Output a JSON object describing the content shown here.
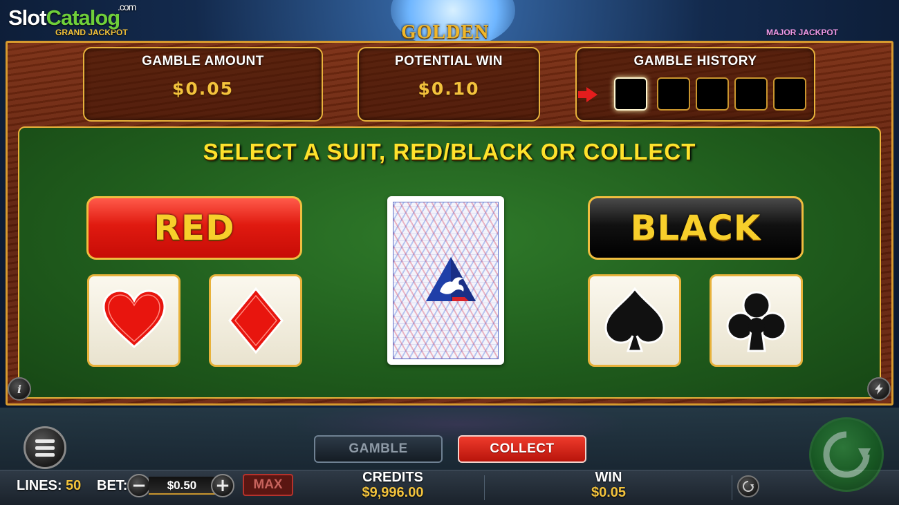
{
  "watermark": {
    "part1": "Slot",
    "part2": "Catalog",
    "suffix": ".com"
  },
  "header": {
    "grand_jackpot_label": "GRAND JACKPOT",
    "game_logo": "GOLDEN",
    "major_jackpot_label": "MAJOR JACKPOT"
  },
  "gamble_amount": {
    "title": "GAMBLE AMOUNT",
    "value": "$0.05"
  },
  "potential_win": {
    "title": "POTENTIAL WIN",
    "value": "$0.10"
  },
  "gamble_history": {
    "title": "GAMBLE HISTORY",
    "slots": 5,
    "current_slot": 1
  },
  "instruction": "SELECT A SUIT, RED/BLACK OR COLLECT",
  "color_choices": {
    "red": "RED",
    "black": "BLACK"
  },
  "suits": [
    "hearts-icon",
    "diamonds-icon",
    "spades-icon",
    "clubs-icon"
  ],
  "colors": {
    "red": "#e01a10",
    "gold": "#f3c33c",
    "felt": "#2f7a2a",
    "wood": "#6e2610"
  },
  "bottom": {
    "lines_label": "LINES:",
    "lines_value": "50",
    "bet_label": "BET:",
    "bet_value": "$0.50",
    "max_label": "MAX",
    "credits_label": "CREDITS",
    "credits_value": "$9,996.00",
    "win_label": "WIN",
    "win_value": "$0.05",
    "gamble_label": "GAMBLE",
    "collect_label": "COLLECT",
    "minus": "−",
    "plus": "+",
    "info_glyph": "i"
  }
}
